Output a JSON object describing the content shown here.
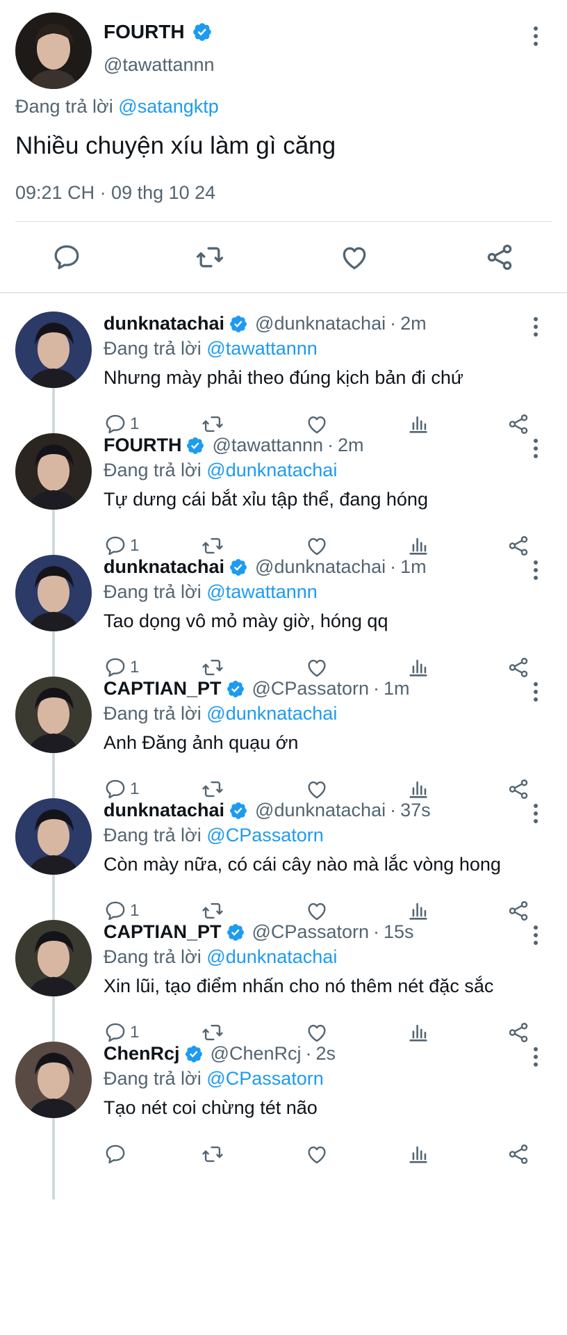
{
  "main_tweet": {
    "author_name": "FOURTH",
    "author_handle": "@tawattannn",
    "reply_prefix": "Đang trả lời",
    "reply_mention": "@satangktp",
    "text": "Nhiều chuyện xíu làm gì căng",
    "timestamp": "09:21 CH · 09 thg 10 24",
    "avatar_color": "#2a2520"
  },
  "colors": {
    "accent": "#1d9bf0",
    "verified": "#1d9bf0",
    "muted_text": "#536471",
    "primary_text": "#0f1419",
    "thread_line": "#cfd9de"
  },
  "icons": {
    "reply": "comment-icon",
    "retweet": "retweet-icon",
    "like": "heart-icon",
    "views": "analytics-icon",
    "share": "share-icon",
    "more": "more-vertical-icon",
    "verified": "verified-badge-icon"
  },
  "replies": [
    {
      "name": "dunknatachai",
      "handle": "@dunknatachai",
      "age": "2m",
      "reply_prefix": "Đang trả lời",
      "reply_mention": "@tawattannn",
      "text": "Nhưng mày phải theo đúng kịch bản đi chứ",
      "reply_count": "1",
      "avatar_color": "#2b3a66"
    },
    {
      "name": "FOURTH",
      "handle": "@tawattannn",
      "age": "2m",
      "reply_prefix": "Đang trả lời",
      "reply_mention": "@dunknatachai",
      "text": "Tự dưng cái bắt xỉu tập thể, đang hóng",
      "reply_count": "1",
      "avatar_color": "#2a2520"
    },
    {
      "name": "dunknatachai",
      "handle": "@dunknatachai",
      "age": "1m",
      "reply_prefix": "Đang trả lời",
      "reply_mention": "@tawattannn",
      "text": "Tao dọng vô mỏ mày giờ, hóng qq",
      "reply_count": "1",
      "avatar_color": "#2b3a66"
    },
    {
      "name": "CAPTIAN_PT",
      "handle": "@CPassatorn",
      "age": "1m",
      "reply_prefix": "Đang trả lời",
      "reply_mention": "@dunknatachai",
      "text": "Anh Đăng ảnh quạu ớn",
      "reply_count": "1",
      "avatar_color": "#3a3a30"
    },
    {
      "name": "dunknatachai",
      "handle": "@dunknatachai",
      "age": "37s",
      "reply_prefix": "Đang trả lời",
      "reply_mention": "@CPassatorn",
      "text": "Còn mày nữa, có cái cây nào mà lắc vòng hong",
      "reply_count": "1",
      "avatar_color": "#2b3a66"
    },
    {
      "name": "CAPTIAN_PT",
      "handle": "@CPassatorn",
      "age": "15s",
      "reply_prefix": "Đang trả lời",
      "reply_mention": "@dunknatachai",
      "text": "Xin lũi, tạo điểm nhấn cho nó thêm nét đặc sắc",
      "reply_count": "1",
      "avatar_color": "#3a3a30"
    },
    {
      "name": "ChenRcj",
      "handle": "@ChenRcj",
      "age": "2s",
      "reply_prefix": "Đang trả lời",
      "reply_mention": "@CPassatorn",
      "text": "Tạo nét coi chừng tét não",
      "reply_count": "",
      "avatar_color": "#5a4a44"
    }
  ]
}
